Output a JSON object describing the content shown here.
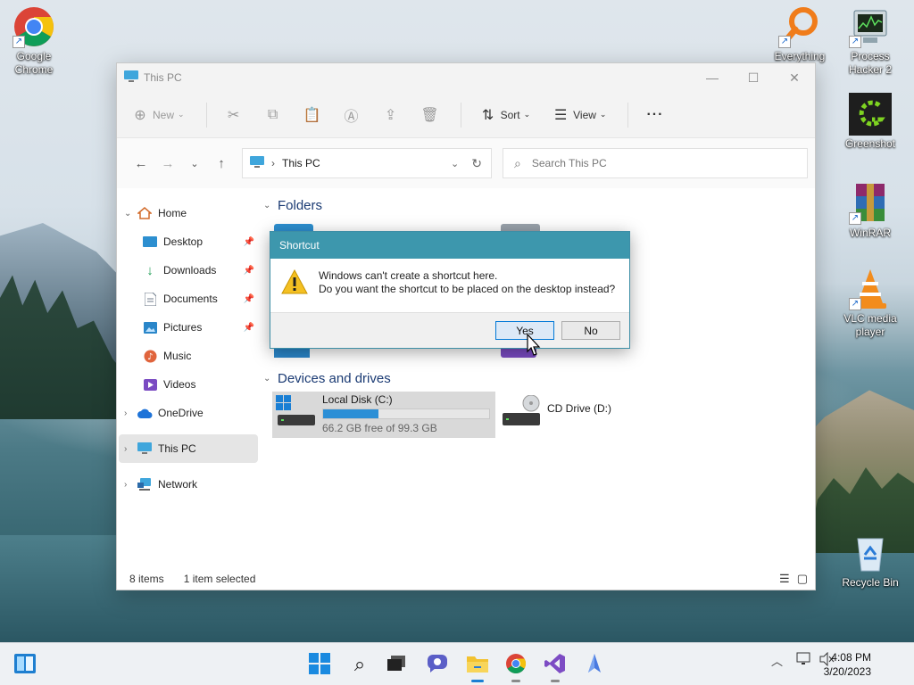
{
  "desktop": {
    "icons": [
      {
        "label": "Google Chrome",
        "icon": "chrome-icon"
      },
      {
        "label": "Everything",
        "icon": "everything-icon"
      },
      {
        "label": "Process Hacker 2",
        "icon": "process-hacker-icon"
      },
      {
        "label": "Greenshot",
        "icon": "greenshot-icon"
      },
      {
        "label": "WinRAR",
        "icon": "winrar-icon"
      },
      {
        "label": "VLC media player",
        "icon": "vlc-icon"
      },
      {
        "label": "Recycle Bin",
        "icon": "recycle-bin-icon"
      }
    ]
  },
  "explorer": {
    "title": "This PC",
    "toolbar": {
      "new_label": "New",
      "sort_label": "Sort",
      "view_label": "View",
      "more_label": "···"
    },
    "address": {
      "path": "This PC"
    },
    "search": {
      "placeholder": "Search This PC"
    },
    "sidebar": {
      "home": "Home",
      "desktop": "Desktop",
      "downloads": "Downloads",
      "documents": "Documents",
      "pictures": "Pictures",
      "music": "Music",
      "videos": "Videos",
      "onedrive": "OneDrive",
      "thispc": "This PC",
      "network": "Network"
    },
    "sections": {
      "folders": "Folders",
      "devices": "Devices and drives"
    },
    "drives": [
      {
        "name": "Local Disk (C:)",
        "free_text": "66.2 GB free of 99.3 GB",
        "used_fraction": 0.333
      },
      {
        "name": "CD Drive (D:)"
      }
    ],
    "status": {
      "items": "8 items",
      "selected": "1 item selected"
    }
  },
  "dialog": {
    "title": "Shortcut",
    "line1": "Windows can't create a shortcut here.",
    "line2": "Do you want the shortcut to be placed on the desktop instead?",
    "yes": "Yes",
    "no": "No"
  },
  "taskbar": {
    "time": "4:08 PM",
    "date": "3/20/2023"
  },
  "colors": {
    "accent": "#0078d7",
    "dialog_title": "#3d97ad",
    "drive_bar": "#2c8fd6"
  }
}
